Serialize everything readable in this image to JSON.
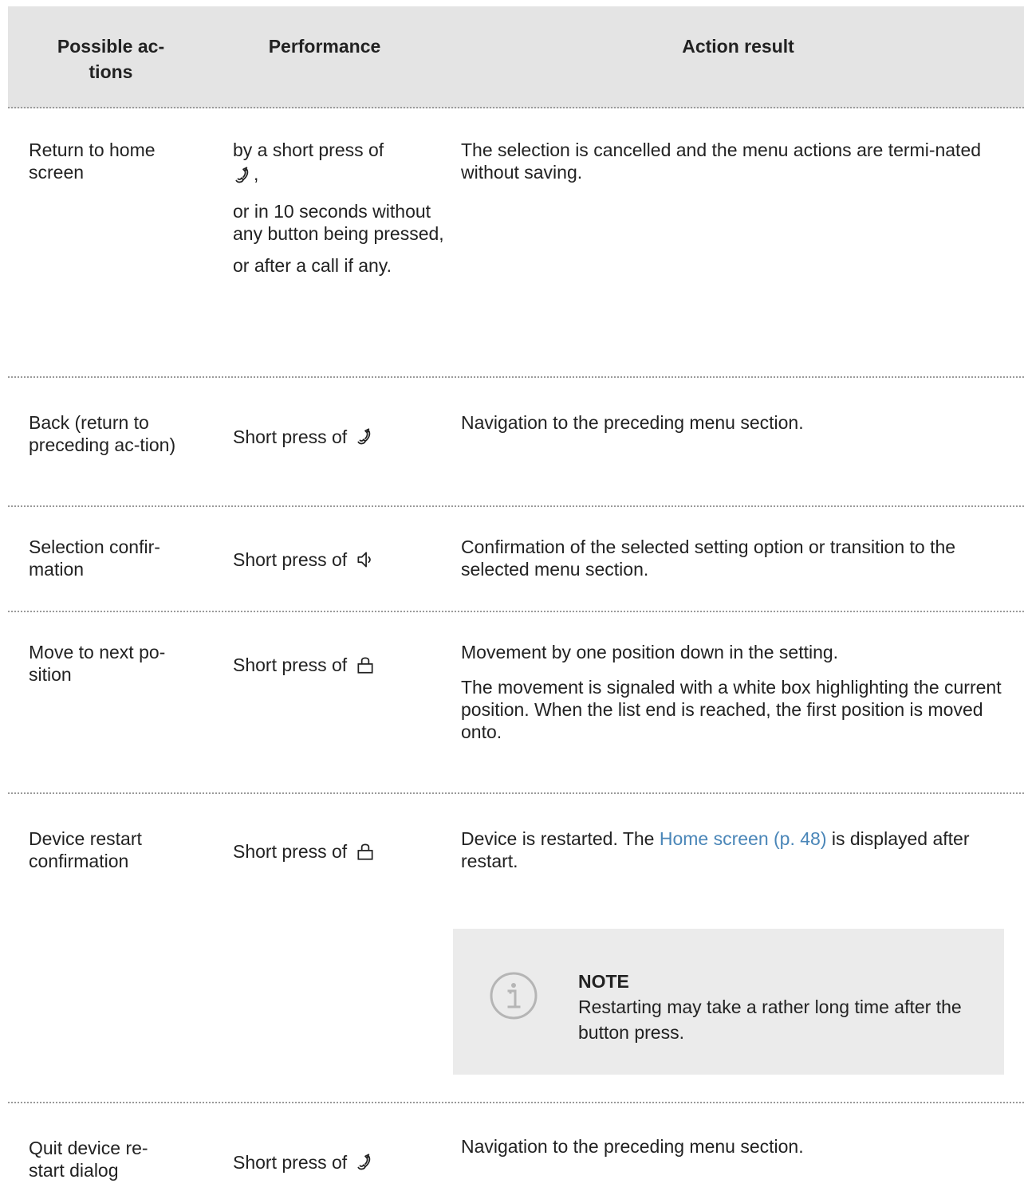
{
  "header": {
    "col1": "Possible ac-\ntions",
    "col2": "Performance",
    "col3": "Action result"
  },
  "rows": [
    {
      "action": "Return to home screen",
      "performance": [
        "by a short press of",
        ",",
        "or in 10 seconds without any button being pressed,",
        "or after a call if any."
      ],
      "result": [
        "The selection is cancelled and the menu actions are termi-nated without saving."
      ]
    },
    {
      "action": "Back (return to preceding ac-tion)",
      "performance": [
        "Short press of"
      ],
      "result": [
        "Navigation to the preceding menu section."
      ]
    },
    {
      "action": "Selection confir-mation",
      "performance": [
        "Short press of"
      ],
      "result": [
        "Confirmation of the selected setting option or transition to the selected menu section."
      ]
    },
    {
      "action": "Move to next po-sition",
      "performance": [
        "Short press of"
      ],
      "result": [
        "Movement by one position down in the setting.",
        "The movement is signaled with a white box highlighting the current position. When the list end is reached, the first position is moved onto."
      ]
    },
    {
      "action": "Device restart confirmation",
      "performance": [
        "Short press of"
      ],
      "result_pre": "Device is restarted. The ",
      "result_link": "Home screen (p. 48)",
      "result_post": " is displayed after restart."
    },
    {
      "action": "Quit device re-start dialog",
      "performance": [
        "Short press of"
      ],
      "result": [
        "Navigation to the preceding menu section."
      ]
    }
  ],
  "note": {
    "title": "NOTE",
    "text": "Restarting may take a rather long time after the button press.",
    "icon": "info-icon"
  },
  "icons": {
    "handset": "handset-icon",
    "speaker": "speaker-icon",
    "lock": "lock-icon"
  }
}
